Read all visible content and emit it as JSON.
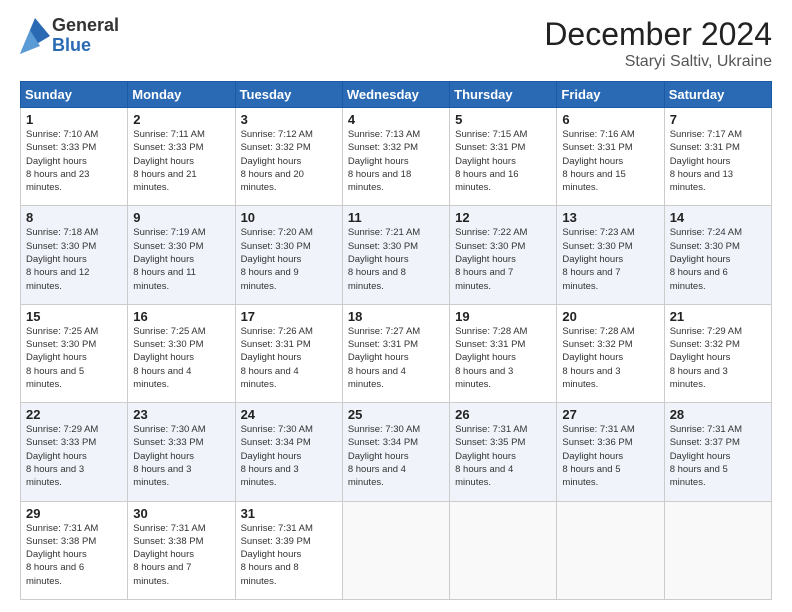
{
  "logo": {
    "general": "General",
    "blue": "Blue"
  },
  "title": "December 2024",
  "location": "Staryi Saltiv, Ukraine",
  "days_header": [
    "Sunday",
    "Monday",
    "Tuesday",
    "Wednesday",
    "Thursday",
    "Friday",
    "Saturday"
  ],
  "weeks": [
    [
      {
        "day": "1",
        "sunrise": "7:10 AM",
        "sunset": "3:33 PM",
        "daylight": "8 hours and 23 minutes."
      },
      {
        "day": "2",
        "sunrise": "7:11 AM",
        "sunset": "3:33 PM",
        "daylight": "8 hours and 21 minutes."
      },
      {
        "day": "3",
        "sunrise": "7:12 AM",
        "sunset": "3:32 PM",
        "daylight": "8 hours and 20 minutes."
      },
      {
        "day": "4",
        "sunrise": "7:13 AM",
        "sunset": "3:32 PM",
        "daylight": "8 hours and 18 minutes."
      },
      {
        "day": "5",
        "sunrise": "7:15 AM",
        "sunset": "3:31 PM",
        "daylight": "8 hours and 16 minutes."
      },
      {
        "day": "6",
        "sunrise": "7:16 AM",
        "sunset": "3:31 PM",
        "daylight": "8 hours and 15 minutes."
      },
      {
        "day": "7",
        "sunrise": "7:17 AM",
        "sunset": "3:31 PM",
        "daylight": "8 hours and 13 minutes."
      }
    ],
    [
      {
        "day": "8",
        "sunrise": "7:18 AM",
        "sunset": "3:30 PM",
        "daylight": "8 hours and 12 minutes."
      },
      {
        "day": "9",
        "sunrise": "7:19 AM",
        "sunset": "3:30 PM",
        "daylight": "8 hours and 11 minutes."
      },
      {
        "day": "10",
        "sunrise": "7:20 AM",
        "sunset": "3:30 PM",
        "daylight": "8 hours and 9 minutes."
      },
      {
        "day": "11",
        "sunrise": "7:21 AM",
        "sunset": "3:30 PM",
        "daylight": "8 hours and 8 minutes."
      },
      {
        "day": "12",
        "sunrise": "7:22 AM",
        "sunset": "3:30 PM",
        "daylight": "8 hours and 7 minutes."
      },
      {
        "day": "13",
        "sunrise": "7:23 AM",
        "sunset": "3:30 PM",
        "daylight": "8 hours and 7 minutes."
      },
      {
        "day": "14",
        "sunrise": "7:24 AM",
        "sunset": "3:30 PM",
        "daylight": "8 hours and 6 minutes."
      }
    ],
    [
      {
        "day": "15",
        "sunrise": "7:25 AM",
        "sunset": "3:30 PM",
        "daylight": "8 hours and 5 minutes."
      },
      {
        "day": "16",
        "sunrise": "7:25 AM",
        "sunset": "3:30 PM",
        "daylight": "8 hours and 4 minutes."
      },
      {
        "day": "17",
        "sunrise": "7:26 AM",
        "sunset": "3:31 PM",
        "daylight": "8 hours and 4 minutes."
      },
      {
        "day": "18",
        "sunrise": "7:27 AM",
        "sunset": "3:31 PM",
        "daylight": "8 hours and 4 minutes."
      },
      {
        "day": "19",
        "sunrise": "7:28 AM",
        "sunset": "3:31 PM",
        "daylight": "8 hours and 3 minutes."
      },
      {
        "day": "20",
        "sunrise": "7:28 AM",
        "sunset": "3:32 PM",
        "daylight": "8 hours and 3 minutes."
      },
      {
        "day": "21",
        "sunrise": "7:29 AM",
        "sunset": "3:32 PM",
        "daylight": "8 hours and 3 minutes."
      }
    ],
    [
      {
        "day": "22",
        "sunrise": "7:29 AM",
        "sunset": "3:33 PM",
        "daylight": "8 hours and 3 minutes."
      },
      {
        "day": "23",
        "sunrise": "7:30 AM",
        "sunset": "3:33 PM",
        "daylight": "8 hours and 3 minutes."
      },
      {
        "day": "24",
        "sunrise": "7:30 AM",
        "sunset": "3:34 PM",
        "daylight": "8 hours and 3 minutes."
      },
      {
        "day": "25",
        "sunrise": "7:30 AM",
        "sunset": "3:34 PM",
        "daylight": "8 hours and 4 minutes."
      },
      {
        "day": "26",
        "sunrise": "7:31 AM",
        "sunset": "3:35 PM",
        "daylight": "8 hours and 4 minutes."
      },
      {
        "day": "27",
        "sunrise": "7:31 AM",
        "sunset": "3:36 PM",
        "daylight": "8 hours and 5 minutes."
      },
      {
        "day": "28",
        "sunrise": "7:31 AM",
        "sunset": "3:37 PM",
        "daylight": "8 hours and 5 minutes."
      }
    ],
    [
      {
        "day": "29",
        "sunrise": "7:31 AM",
        "sunset": "3:38 PM",
        "daylight": "8 hours and 6 minutes."
      },
      {
        "day": "30",
        "sunrise": "7:31 AM",
        "sunset": "3:38 PM",
        "daylight": "8 hours and 7 minutes."
      },
      {
        "day": "31",
        "sunrise": "7:31 AM",
        "sunset": "3:39 PM",
        "daylight": "8 hours and 8 minutes."
      },
      null,
      null,
      null,
      null
    ]
  ]
}
